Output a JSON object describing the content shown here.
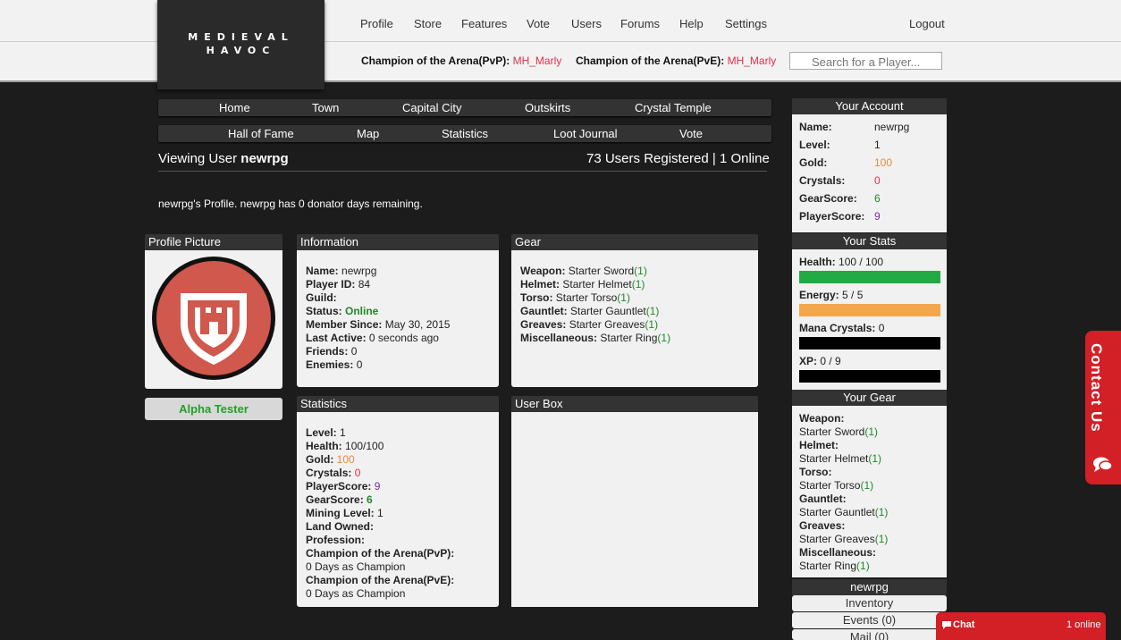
{
  "logo": {
    "line1": "MEDIEVAL",
    "line2": "HAVOC"
  },
  "top_nav": [
    "Profile",
    "Store",
    "Features",
    "Vote",
    "Users",
    "Forums",
    "Help",
    "Settings"
  ],
  "logout": "Logout",
  "champions": {
    "pvp_label": "Champion of the Arena(PvP):",
    "pvp_name": "MH_Marly",
    "pve_label": "Champion of the Arena(PvE):",
    "pve_name": "MH_Marly"
  },
  "search": {
    "placeholder": "Search for a Player..."
  },
  "main_nav_row1": [
    "Home",
    "Town",
    "Capital City",
    "Outskirts",
    "Crystal Temple"
  ],
  "main_nav_row2": [
    "Hall of Fame",
    "Map",
    "Statistics",
    "Loot Journal",
    "Vote"
  ],
  "viewing": {
    "prefix": "Viewing User",
    "user": "newrpg"
  },
  "registered": "73 Users Registered | 1 Online",
  "profile_line": "newrpg's Profile. newrpg has 0 donator days remaining.",
  "profile_picture": {
    "title": "Profile Picture",
    "badge": "Alpha Tester"
  },
  "information": {
    "title": "Information",
    "name_label": "Name:",
    "name": "newrpg",
    "id_label": "Player ID:",
    "id": "84",
    "guild_label": "Guild:",
    "status_label": "Status:",
    "status": "Online",
    "since_label": "Member Since:",
    "since": "May 30, 2015",
    "active_label": "Last Active:",
    "active": "0 seconds ago",
    "friends_label": "Friends:",
    "friends": "0",
    "enemies_label": "Enemies:",
    "enemies": "0"
  },
  "gear": {
    "title": "Gear",
    "items": [
      {
        "slot": "Weapon:",
        "item": "Starter Sword",
        "level": "(1)"
      },
      {
        "slot": "Helmet:",
        "item": "Starter Helmet",
        "level": "(1)"
      },
      {
        "slot": "Torso:",
        "item": "Starter Torso",
        "level": "(1)"
      },
      {
        "slot": "Gauntlet:",
        "item": "Starter Gauntlet",
        "level": "(1)"
      },
      {
        "slot": "Greaves:",
        "item": "Starter Greaves",
        "level": "(1)"
      },
      {
        "slot": "Miscellaneous:",
        "item": "Starter Ring",
        "level": "(1)"
      }
    ]
  },
  "statistics": {
    "title": "Statistics",
    "level_label": "Level:",
    "level": "1",
    "health_label": "Health:",
    "health": "100/100",
    "gold_label": "Gold:",
    "gold": "100",
    "crystals_label": "Crystals:",
    "crystals": "0",
    "playerscore_label": "PlayerScore:",
    "playerscore": "9",
    "gearscore_label": "GearScore:",
    "gearscore": "6",
    "mining_label": "Mining Level:",
    "mining": "1",
    "land_label": "Land Owned:",
    "profession_label": "Profession:",
    "pvp_label": "Champion of the Arena(PvP):",
    "pvp": "0 Days as Champion",
    "pve_label": "Champion of the Arena(PvE):",
    "pve": "0 Days as Champion"
  },
  "user_box": {
    "title": "User Box"
  },
  "account": {
    "title": "Your Account",
    "name_label": "Name:",
    "name": "newrpg",
    "level_label": "Level:",
    "level": "1",
    "gold_label": "Gold:",
    "gold": "100",
    "crystals_label": "Crystals:",
    "crystals": "0",
    "gearscore_label": "GearScore:",
    "gearscore": "6",
    "playerscore_label": "PlayerScore:",
    "playerscore": "9"
  },
  "stats": {
    "title": "Your Stats",
    "health_label": "Health:",
    "health": "100 / 100",
    "health_fraction": 1.0,
    "energy_label": "Energy:",
    "energy": "5 / 5",
    "energy_fraction": 1.0,
    "mana_label": "Mana Crystals:",
    "mana": "0",
    "mana_fraction": 0.0,
    "xp_label": "XP:",
    "xp": "0 / 9",
    "xp_fraction": 0.0
  },
  "your_gear": {
    "title": "Your Gear",
    "items": [
      {
        "slot": "Weapon:",
        "item": "Starter Sword",
        "level": "(1)"
      },
      {
        "slot": "Helmet:",
        "item": "Starter Helmet",
        "level": "(1)"
      },
      {
        "slot": "Torso:",
        "item": "Starter Torso",
        "level": "(1)"
      },
      {
        "slot": "Gauntlet:",
        "item": "Starter Gauntlet",
        "level": "(1)"
      },
      {
        "slot": "Greaves:",
        "item": "Starter Greaves",
        "level": "(1)"
      },
      {
        "slot": "Miscellaneous:",
        "item": "Starter Ring",
        "level": "(1)"
      }
    ]
  },
  "user_menu": {
    "title": "newrpg",
    "inventory": "Inventory",
    "events": "Events (0)",
    "mail": "Mail (0)"
  },
  "contact": "Contact Us",
  "chat": {
    "label": "Chat",
    "online": "1 online"
  },
  "colors": {
    "health": "#22aa44",
    "energy": "#f4a64c",
    "empty_bar": "#000000",
    "accent_red": "#d31f26",
    "link_red": "#e0304a"
  }
}
